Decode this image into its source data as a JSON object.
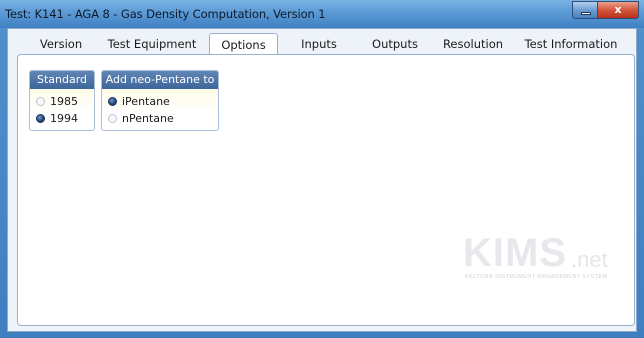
{
  "window": {
    "title": "Test: K141 - AGA 8 - Gas Density Computation, Version 1",
    "minimize_glyph": "",
    "close_glyph": "x"
  },
  "tabs": [
    {
      "label": "Version",
      "active": false
    },
    {
      "label": "Test Equipment",
      "active": false
    },
    {
      "label": "Options",
      "active": true
    },
    {
      "label": "Inputs",
      "active": false
    },
    {
      "label": "Outputs",
      "active": false
    },
    {
      "label": "Resolution",
      "active": false
    },
    {
      "label": "Test Information",
      "active": false
    }
  ],
  "standard": {
    "title": "Standard",
    "options": [
      {
        "label": "1985",
        "checked": false
      },
      {
        "label": "1994",
        "checked": true
      }
    ]
  },
  "neopentane": {
    "title": "Add neo-Pentane to",
    "options": [
      {
        "label": "iPentane",
        "checked": true
      },
      {
        "label": "nPentane",
        "checked": false
      }
    ]
  },
  "logo": {
    "main": "KIMS",
    "suffix": ".net",
    "tagline": "KELTON® INSTRUMENT MANAGEMENT SYSTEM"
  },
  "colors": {
    "title_bar": "#5b9ad5",
    "group_header": "#4a72a6",
    "close_button": "#d4553d"
  }
}
